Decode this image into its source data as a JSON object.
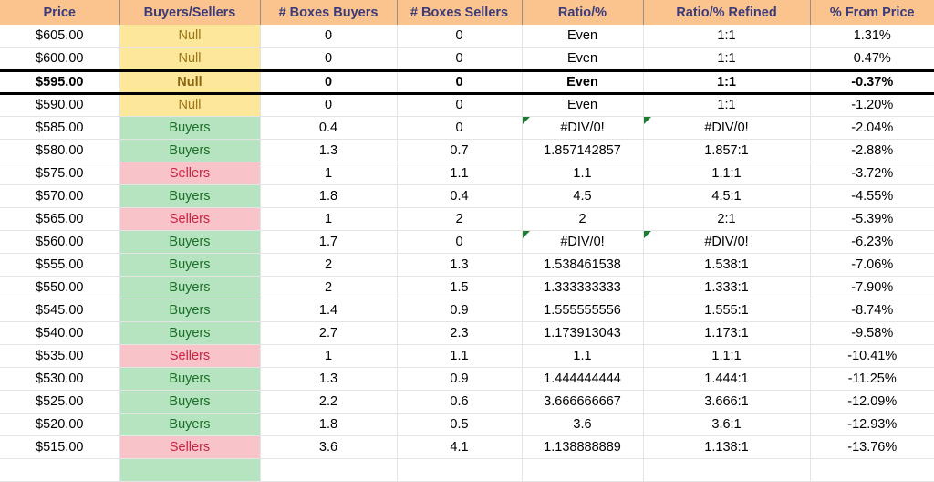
{
  "table": {
    "columns": [
      {
        "key": "price",
        "label": "Price"
      },
      {
        "key": "bs",
        "label": "Buyers/Sellers"
      },
      {
        "key": "box_buyers",
        "label": "# Boxes Buyers"
      },
      {
        "key": "box_sellers",
        "label": "# Boxes Sellers"
      },
      {
        "key": "ratio",
        "label": "Ratio/%"
      },
      {
        "key": "ratio_ref",
        "label": "Ratio/% Refined"
      },
      {
        "key": "pct",
        "label": "% From Price"
      }
    ],
    "colors": {
      "header_bg": "#fbc38d",
      "header_text": "#3b3b7a",
      "null_bg": "#fce79a",
      "null_text": "#9c7516",
      "buyers_bg": "#b6e3c0",
      "buyers_text": "#1b7028",
      "sellers_bg": "#f9c3ca",
      "sellers_text": "#cc2241",
      "error_flag": "#1e7b32",
      "grid_line": "#e4e4e4",
      "highlight_border": "#000000"
    },
    "rows": [
      {
        "price": "$605.00",
        "bs": "Null",
        "cat": "null",
        "box_buyers": "0",
        "box_sellers": "0",
        "ratio": "Even",
        "ratio_err": false,
        "ratio_ref": "1:1",
        "ratio_ref_err": false,
        "pct": "1.31%",
        "highlight": false
      },
      {
        "price": "$600.00",
        "bs": "Null",
        "cat": "null",
        "box_buyers": "0",
        "box_sellers": "0",
        "ratio": "Even",
        "ratio_err": false,
        "ratio_ref": "1:1",
        "ratio_ref_err": false,
        "pct": "0.47%",
        "highlight": false
      },
      {
        "price": "$595.00",
        "bs": "Null",
        "cat": "null",
        "box_buyers": "0",
        "box_sellers": "0",
        "ratio": "Even",
        "ratio_err": false,
        "ratio_ref": "1:1",
        "ratio_ref_err": false,
        "pct": "-0.37%",
        "highlight": true
      },
      {
        "price": "$590.00",
        "bs": "Null",
        "cat": "null",
        "box_buyers": "0",
        "box_sellers": "0",
        "ratio": "Even",
        "ratio_err": false,
        "ratio_ref": "1:1",
        "ratio_ref_err": false,
        "pct": "-1.20%",
        "highlight": false
      },
      {
        "price": "$585.00",
        "bs": "Buyers",
        "cat": "buyers",
        "box_buyers": "0.4",
        "box_sellers": "0",
        "ratio": "#DIV/0!",
        "ratio_err": true,
        "ratio_ref": "#DIV/0!",
        "ratio_ref_err": true,
        "pct": "-2.04%",
        "highlight": false
      },
      {
        "price": "$580.00",
        "bs": "Buyers",
        "cat": "buyers",
        "box_buyers": "1.3",
        "box_sellers": "0.7",
        "ratio": "1.857142857",
        "ratio_err": false,
        "ratio_ref": "1.857:1",
        "ratio_ref_err": false,
        "pct": "-2.88%",
        "highlight": false
      },
      {
        "price": "$575.00",
        "bs": "Sellers",
        "cat": "sellers",
        "box_buyers": "1",
        "box_sellers": "1.1",
        "ratio": "1.1",
        "ratio_err": false,
        "ratio_ref": "1.1:1",
        "ratio_ref_err": false,
        "pct": "-3.72%",
        "highlight": false
      },
      {
        "price": "$570.00",
        "bs": "Buyers",
        "cat": "buyers",
        "box_buyers": "1.8",
        "box_sellers": "0.4",
        "ratio": "4.5",
        "ratio_err": false,
        "ratio_ref": "4.5:1",
        "ratio_ref_err": false,
        "pct": "-4.55%",
        "highlight": false
      },
      {
        "price": "$565.00",
        "bs": "Sellers",
        "cat": "sellers",
        "box_buyers": "1",
        "box_sellers": "2",
        "ratio": "2",
        "ratio_err": false,
        "ratio_ref": "2:1",
        "ratio_ref_err": false,
        "pct": "-5.39%",
        "highlight": false
      },
      {
        "price": "$560.00",
        "bs": "Buyers",
        "cat": "buyers",
        "box_buyers": "1.7",
        "box_sellers": "0",
        "ratio": "#DIV/0!",
        "ratio_err": true,
        "ratio_ref": "#DIV/0!",
        "ratio_ref_err": true,
        "pct": "-6.23%",
        "highlight": false
      },
      {
        "price": "$555.00",
        "bs": "Buyers",
        "cat": "buyers",
        "box_buyers": "2",
        "box_sellers": "1.3",
        "ratio": "1.538461538",
        "ratio_err": false,
        "ratio_ref": "1.538:1",
        "ratio_ref_err": false,
        "pct": "-7.06%",
        "highlight": false
      },
      {
        "price": "$550.00",
        "bs": "Buyers",
        "cat": "buyers",
        "box_buyers": "2",
        "box_sellers": "1.5",
        "ratio": "1.333333333",
        "ratio_err": false,
        "ratio_ref": "1.333:1",
        "ratio_ref_err": false,
        "pct": "-7.90%",
        "highlight": false
      },
      {
        "price": "$545.00",
        "bs": "Buyers",
        "cat": "buyers",
        "box_buyers": "1.4",
        "box_sellers": "0.9",
        "ratio": "1.555555556",
        "ratio_err": false,
        "ratio_ref": "1.555:1",
        "ratio_ref_err": false,
        "pct": "-8.74%",
        "highlight": false
      },
      {
        "price": "$540.00",
        "bs": "Buyers",
        "cat": "buyers",
        "box_buyers": "2.7",
        "box_sellers": "2.3",
        "ratio": "1.173913043",
        "ratio_err": false,
        "ratio_ref": "1.173:1",
        "ratio_ref_err": false,
        "pct": "-9.58%",
        "highlight": false
      },
      {
        "price": "$535.00",
        "bs": "Sellers",
        "cat": "sellers",
        "box_buyers": "1",
        "box_sellers": "1.1",
        "ratio": "1.1",
        "ratio_err": false,
        "ratio_ref": "1.1:1",
        "ratio_ref_err": false,
        "pct": "-10.41%",
        "highlight": false
      },
      {
        "price": "$530.00",
        "bs": "Buyers",
        "cat": "buyers",
        "box_buyers": "1.3",
        "box_sellers": "0.9",
        "ratio": "1.444444444",
        "ratio_err": false,
        "ratio_ref": "1.444:1",
        "ratio_ref_err": false,
        "pct": "-11.25%",
        "highlight": false
      },
      {
        "price": "$525.00",
        "bs": "Buyers",
        "cat": "buyers",
        "box_buyers": "2.2",
        "box_sellers": "0.6",
        "ratio": "3.666666667",
        "ratio_err": false,
        "ratio_ref": "3.666:1",
        "ratio_ref_err": false,
        "pct": "-12.09%",
        "highlight": false
      },
      {
        "price": "$520.00",
        "bs": "Buyers",
        "cat": "buyers",
        "box_buyers": "1.8",
        "box_sellers": "0.5",
        "ratio": "3.6",
        "ratio_err": false,
        "ratio_ref": "3.6:1",
        "ratio_ref_err": false,
        "pct": "-12.93%",
        "highlight": false
      },
      {
        "price": "$515.00",
        "bs": "Sellers",
        "cat": "sellers",
        "box_buyers": "3.6",
        "box_sellers": "4.1",
        "ratio": "1.138888889",
        "ratio_err": false,
        "ratio_ref": "1.138:1",
        "ratio_ref_err": false,
        "pct": "-13.76%",
        "highlight": false
      },
      {
        "price": "",
        "bs": "",
        "cat": "buyers",
        "box_buyers": "",
        "box_sellers": "",
        "ratio": "",
        "ratio_err": false,
        "ratio_ref": "",
        "ratio_ref_err": false,
        "pct": "",
        "highlight": false
      }
    ]
  }
}
